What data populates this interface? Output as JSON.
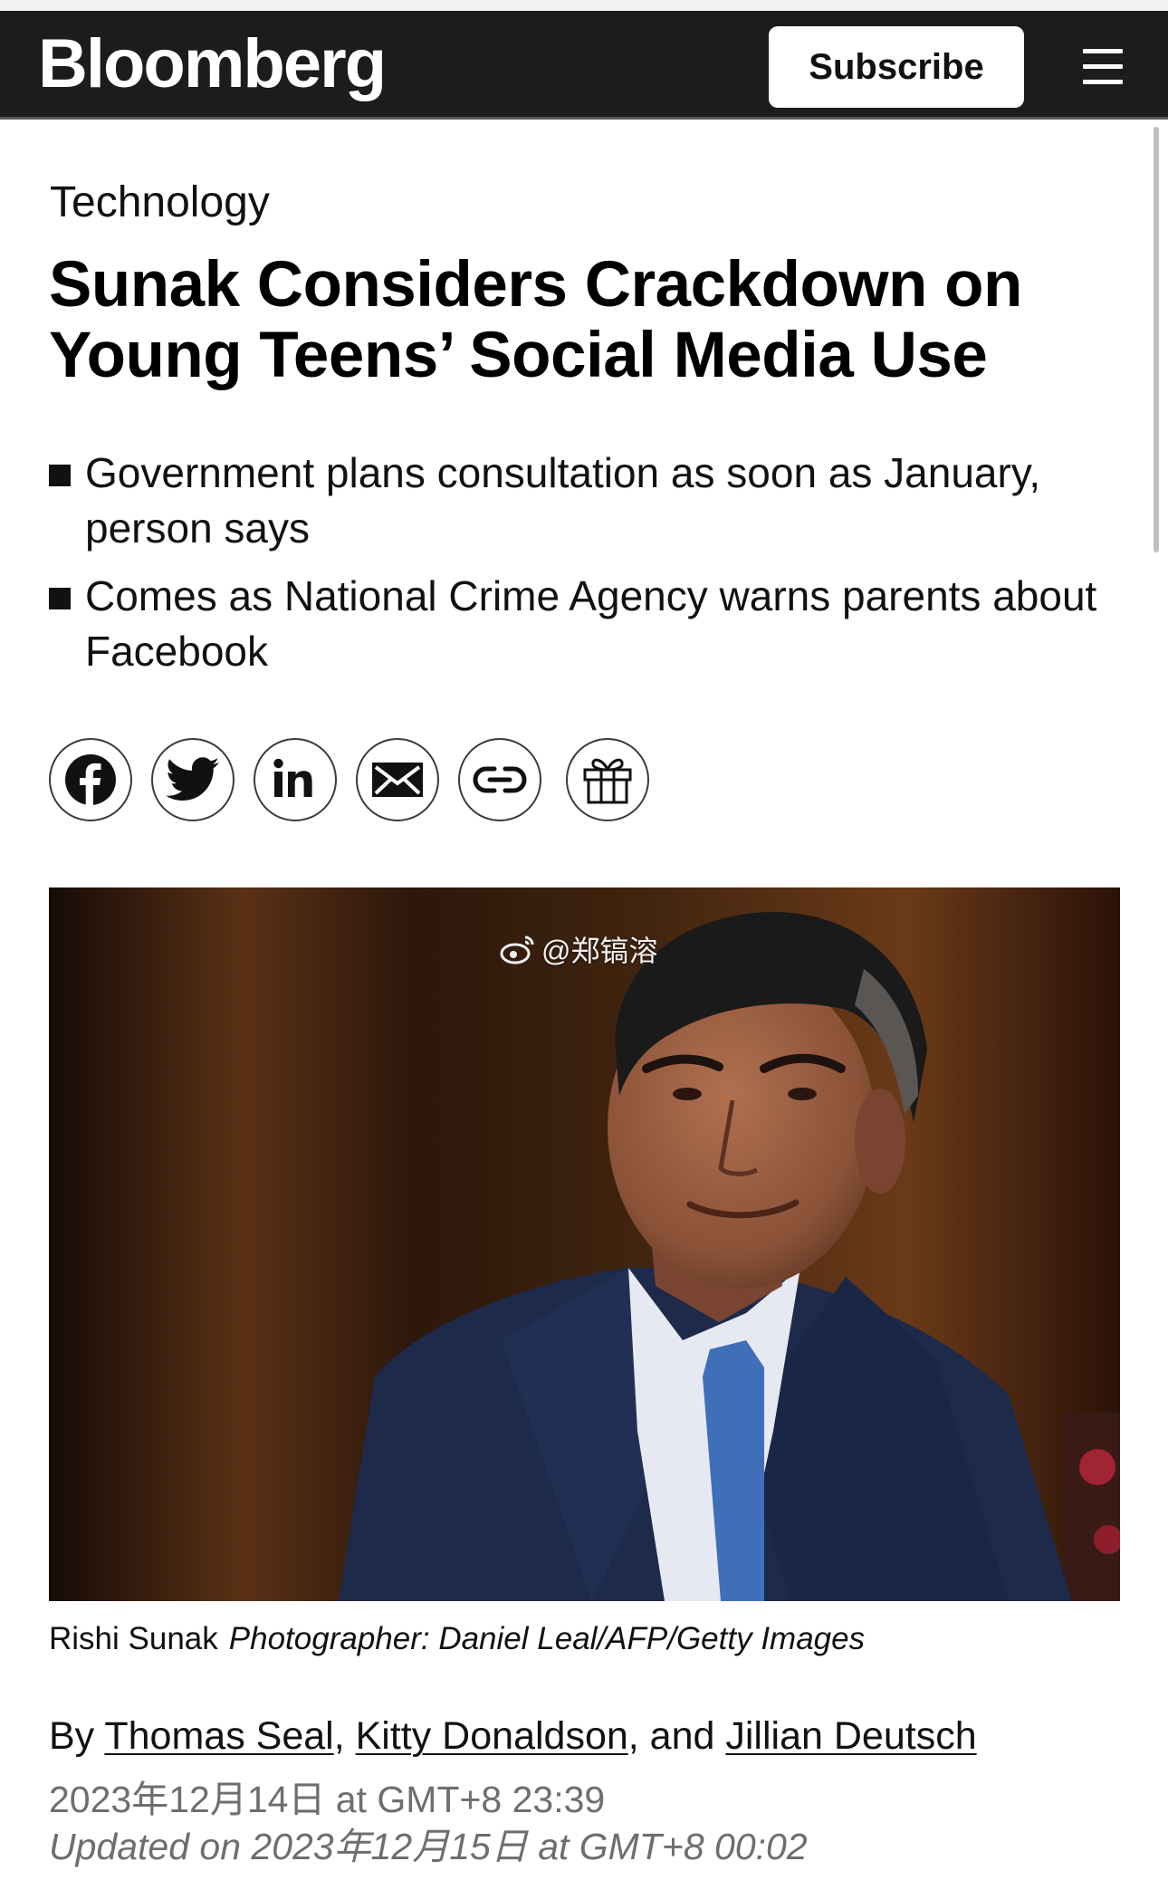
{
  "header": {
    "logo": "Bloomberg",
    "subscribe_label": "Subscribe"
  },
  "article": {
    "section": "Technology",
    "headline": "Sunak Considers Crackdown on Young Teens’ Social Media Use",
    "bullets": [
      "Government plans consultation as soon as January, person says",
      "Comes as National Crime Agency warns parents about Facebook"
    ],
    "share_icons": [
      "facebook-icon",
      "twitter-icon",
      "linkedin-icon",
      "email-icon",
      "link-icon",
      "gift-icon"
    ],
    "image": {
      "watermark": "@郑镐溶",
      "caption": "Rishi Sunak",
      "credit": "Photographer: Daniel Leal/AFP/Getty Images"
    },
    "byline": {
      "prefix": "By ",
      "authors": [
        "Thomas Seal",
        "Kitty Donaldson",
        "Jillian Deutsch"
      ],
      "sep1": ", ",
      "sep2": ", and "
    },
    "published": "2023年12月14日 at GMT+8 23:39",
    "updated": "Updated on 2023年12月15日 at GMT+8 00:02"
  },
  "colors": {
    "header_bg": "#1c1c1c",
    "text": "#111111",
    "meta_gray": "#6e6e6e"
  }
}
